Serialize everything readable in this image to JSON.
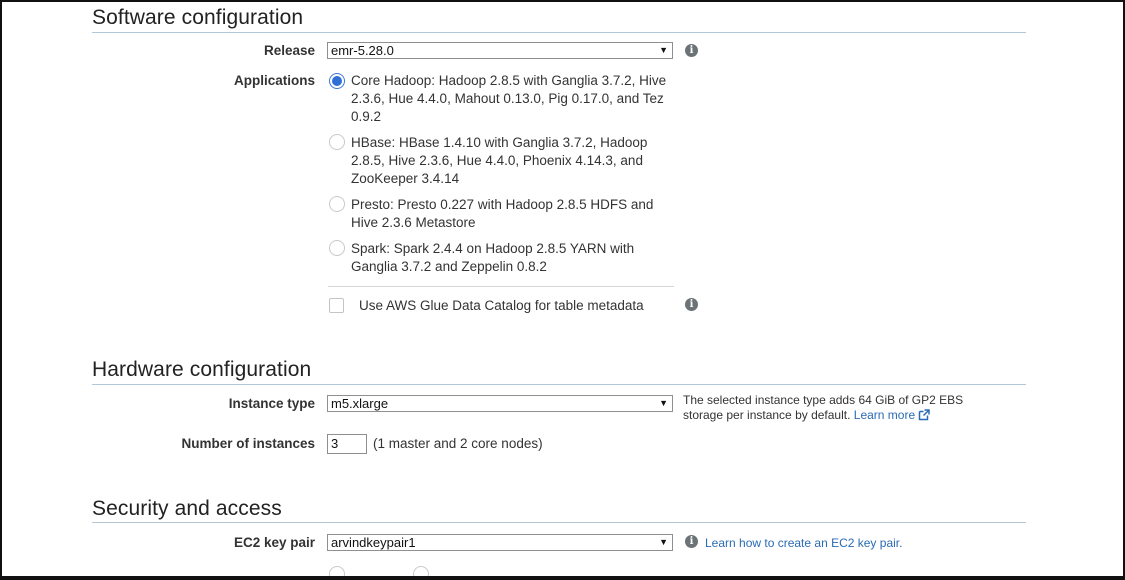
{
  "software": {
    "title": "Software configuration",
    "release_label": "Release",
    "release_value": "emr-5.28.0",
    "applications_label": "Applications",
    "applications": [
      {
        "text": "Core Hadoop: Hadoop 2.8.5 with Ganglia 3.7.2, Hive 2.3.6, Hue 4.4.0, Mahout 0.13.0, Pig 0.17.0, and Tez 0.9.2",
        "selected": true
      },
      {
        "text": "HBase: HBase 1.4.10 with Ganglia 3.7.2, Hadoop 2.8.5, Hive 2.3.6, Hue 4.4.0, Phoenix 4.14.3, and ZooKeeper 3.4.14",
        "selected": false
      },
      {
        "text": "Presto: Presto 0.227 with Hadoop 2.8.5 HDFS and Hive 2.3.6 Metastore",
        "selected": false
      },
      {
        "text": "Spark: Spark 2.4.4 on Hadoop 2.8.5 YARN with Ganglia 3.7.2 and Zeppelin 0.8.2",
        "selected": false
      }
    ],
    "glue_label": "Use AWS Glue Data Catalog for table metadata",
    "glue_checked": false
  },
  "hardware": {
    "title": "Hardware configuration",
    "instance_type_label": "Instance type",
    "instance_type_value": "m5.xlarge",
    "instance_note": "The selected instance type adds 64 GiB of GP2 EBS storage per instance by default.",
    "learn_more": "Learn more",
    "num_instances_label": "Number of instances",
    "num_instances_value": "3",
    "num_instances_note": "(1 master and 2 core nodes)"
  },
  "security": {
    "title": "Security and access",
    "key_pair_label": "EC2 key pair",
    "key_pair_value": "arvindkeypair1",
    "key_pair_help": "Learn how to create an EC2 key pair."
  },
  "icons": {
    "info": "info-icon",
    "caret": "chevron-down-icon",
    "external": "external-link-icon"
  },
  "colors": {
    "accent": "#2f6fd6",
    "link": "#2a6bb3",
    "rule": "#b4c7d6"
  }
}
